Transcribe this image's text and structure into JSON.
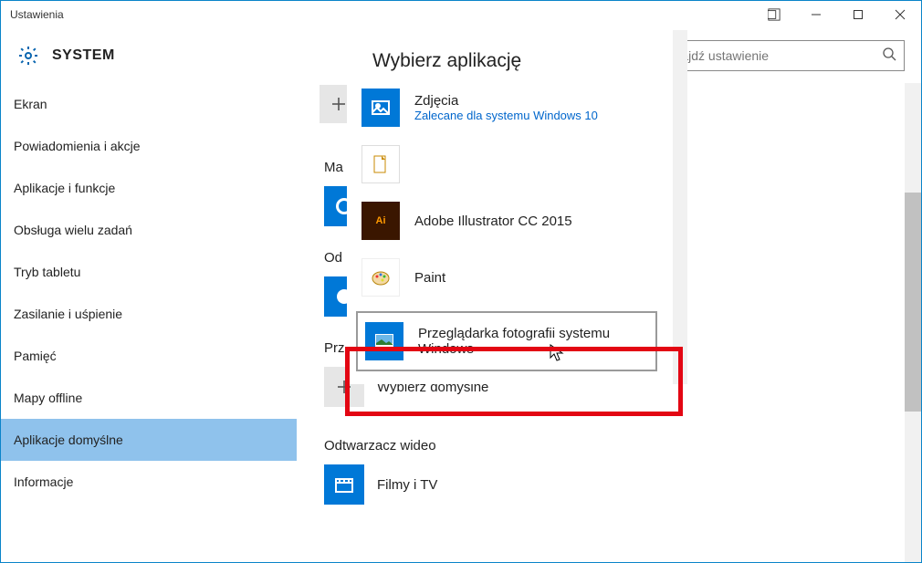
{
  "titlebar": {
    "title": "Ustawienia"
  },
  "header": {
    "title": "SYSTEM",
    "search_placeholder": "Znajdź ustawienie"
  },
  "sidebar": {
    "items": [
      {
        "label": "Ekran"
      },
      {
        "label": "Powiadomienia i akcje"
      },
      {
        "label": "Aplikacje i funkcje"
      },
      {
        "label": "Obsługa wielu zadań"
      },
      {
        "label": "Tryb tabletu"
      },
      {
        "label": "Zasilanie i uśpienie"
      },
      {
        "label": "Pamięć"
      },
      {
        "label": "Mapy offline"
      },
      {
        "label": "Aplikacje domyślne"
      },
      {
        "label": "Informacje"
      }
    ],
    "active_index": 8
  },
  "main": {
    "partial_labels": {
      "ma": "Ma",
      "od": "Od",
      "prz": "Prz"
    },
    "choose_default": "Wybierz domyślne",
    "video_player_heading": "Odtwarzacz wideo",
    "video_app": "Filmy i TV"
  },
  "popup": {
    "title": "Wybierz aplikację",
    "items": [
      {
        "name": "Zdjęcia",
        "recommended": "Zalecane dla systemu Windows 10",
        "icon": "photos"
      },
      {
        "name": "",
        "icon": "libreoffice"
      },
      {
        "name": "Adobe Illustrator CC 2015",
        "icon": "illustrator"
      },
      {
        "name": "Paint",
        "icon": "paint"
      },
      {
        "name": "Przeglądarka fotografii systemu Windows",
        "icon": "photoviewer"
      }
    ]
  }
}
